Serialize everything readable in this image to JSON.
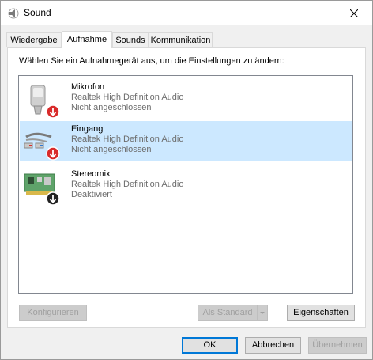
{
  "window": {
    "title": "Sound"
  },
  "tabs": [
    {
      "label": "Wiedergabe"
    },
    {
      "label": "Aufnahme"
    },
    {
      "label": "Sounds"
    },
    {
      "label": "Kommunikation"
    }
  ],
  "instruction": "Wählen Sie ein Aufnahmegerät aus, um die Einstellungen zu ändern:",
  "devices": [
    {
      "name": "Mikrofon",
      "driver": "Realtek High Definition Audio",
      "status": "Nicht angeschlossen",
      "icon": "microphone-icon",
      "badge": "red-down-arrow"
    },
    {
      "name": "Eingang",
      "driver": "Realtek High Definition Audio",
      "status": "Nicht angeschlossen",
      "icon": "line-in-cable-icon",
      "badge": "red-down-arrow",
      "selected": true
    },
    {
      "name": "Stereomix",
      "driver": "Realtek High Definition Audio",
      "status": "Deaktiviert",
      "icon": "sound-card-icon",
      "badge": "black-down-arrow"
    }
  ],
  "buttons": {
    "configure": "Konfigurieren",
    "set_default": "Als Standard",
    "properties": "Eigenschaften",
    "ok": "OK",
    "cancel": "Abbrechen",
    "apply": "Übernehmen"
  },
  "colors": {
    "selection": "#cce8ff",
    "accent": "#0078d7",
    "badge_red": "#d92b2b"
  }
}
